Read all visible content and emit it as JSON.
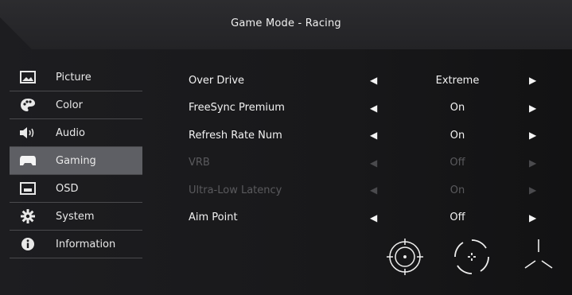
{
  "header": {
    "title": "Game Mode - Racing"
  },
  "menu": {
    "items": [
      {
        "label": "Picture",
        "icon": "picture-icon",
        "active": false
      },
      {
        "label": "Color",
        "icon": "palette-icon",
        "active": false
      },
      {
        "label": "Audio",
        "icon": "speaker-icon",
        "active": false
      },
      {
        "label": "Gaming",
        "icon": "gamepad-icon",
        "active": true
      },
      {
        "label": "OSD",
        "icon": "osd-icon",
        "active": false
      },
      {
        "label": "System",
        "icon": "gear-icon",
        "active": false
      },
      {
        "label": "Information",
        "icon": "info-icon",
        "active": false
      }
    ]
  },
  "settings": [
    {
      "label": "Over Drive",
      "value": "Extreme",
      "enabled": true
    },
    {
      "label": "FreeSync Premium",
      "value": "On",
      "enabled": true
    },
    {
      "label": "Refresh Rate Num",
      "value": "On",
      "enabled": true
    },
    {
      "label": "VRB",
      "value": "Off",
      "enabled": false
    },
    {
      "label": "Ultra-Low Latency",
      "value": "On",
      "enabled": false
    },
    {
      "label": "Aim Point",
      "value": "Off",
      "enabled": true
    }
  ],
  "aim_points": [
    {
      "icon": "aim-point-1-icon"
    },
    {
      "icon": "aim-point-2-icon"
    },
    {
      "icon": "aim-point-3-icon"
    }
  ],
  "arrows": {
    "left": "◀",
    "right": "▶"
  },
  "colors": {
    "active_bg": "#5e5f64",
    "text": "#f2f2f2",
    "disabled": "#5a5a5d"
  }
}
